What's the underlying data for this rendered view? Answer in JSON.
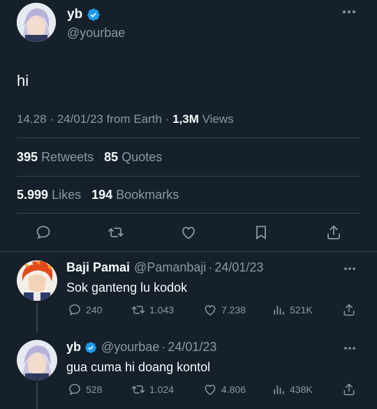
{
  "main": {
    "name": "yb",
    "handle": "@yourbae",
    "text": "hi",
    "time": "14.28",
    "date": "24/01/23",
    "source": "from Earth",
    "views_count": "1,3M",
    "views_label": "Views",
    "retweets_count": "395",
    "retweets_label": "Retweets",
    "quotes_count": "85",
    "quotes_label": "Quotes",
    "likes_count": "5.999",
    "likes_label": "Likes",
    "bookmarks_count": "194",
    "bookmarks_label": "Bookmarks"
  },
  "replies": [
    {
      "name": "Baji Pamai",
      "handle": "@Pamanbaji",
      "date": "24/01/23",
      "text": "Sok ganteng lu kodok",
      "reply_count": "240",
      "retweet_count": "1.043",
      "like_count": "7.238",
      "view_count": "521K"
    },
    {
      "name": "yb",
      "handle": "@yourbae",
      "date": "24/01/23",
      "text": "gua cuma hi doang kontol",
      "reply_count": "528",
      "retweet_count": "1.024",
      "like_count": "4.806",
      "view_count": "438K"
    }
  ],
  "separator": "·",
  "colors": {
    "background": "#15202b",
    "muted": "#8b98a5",
    "verified": "#1d9bf0",
    "divider": "#38444d"
  }
}
